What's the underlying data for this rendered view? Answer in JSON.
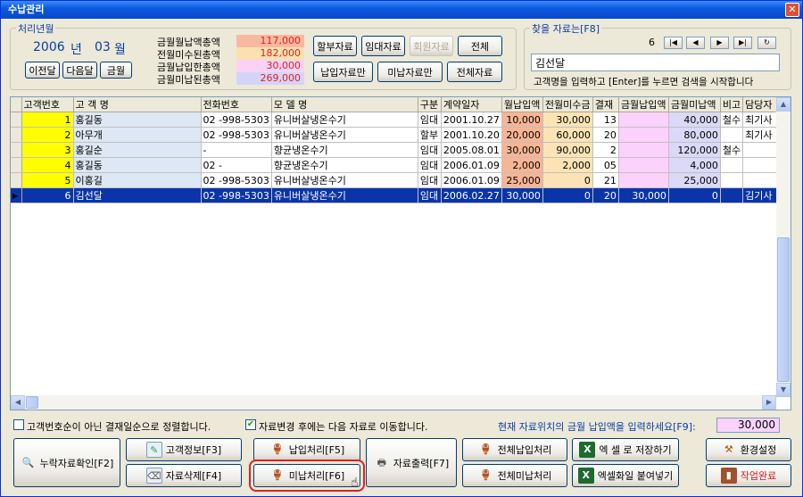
{
  "window": {
    "title": "수납관리"
  },
  "period": {
    "group_title": "처리년월",
    "year": "2006",
    "year_unit": "년",
    "month": "03",
    "month_unit": "월",
    "prev_month": "이전달",
    "next_month": "다음달",
    "this_month": "금월"
  },
  "summary": {
    "rows": [
      {
        "label": "금월월납액총액",
        "value": "117,000",
        "color": "#f9b9a0"
      },
      {
        "label": "전월미수된총액",
        "value": "182,000",
        "color": "#fbe0b0"
      },
      {
        "label": "금월납입한총액",
        "value": "30,000",
        "color": "#fbd2f5"
      },
      {
        "label": "금월미납된총액",
        "value": "269,000",
        "color": "#d4d4f9"
      }
    ]
  },
  "filters": {
    "installment": "할부자료",
    "rental": "임대자료",
    "member": "회원자료",
    "all": "전체",
    "paid_only": "납입자료만",
    "unpaid_only": "미납자료만",
    "all_data": "전체자료"
  },
  "search": {
    "group_title": "찾을 자료는[F8]",
    "position": "6",
    "value": "김선달",
    "hint": "고객명을 입력하고 [Enter]를 누르면 검색을 시작합니다"
  },
  "grid": {
    "columns": [
      "고객번호",
      "고 객 명",
      "전화번호",
      "모  델  명",
      "구분",
      "계약일자",
      "월납입액",
      "전월미수금",
      "결재",
      "금월납입액",
      "금월미납액",
      "비고",
      "담당자"
    ],
    "rows": [
      {
        "code": "1",
        "name": "홍길동",
        "phone": "02  -998-5303",
        "model": "유니버살냉온수기",
        "type": "임대",
        "date": "2001.10.27",
        "monthly": "10,000",
        "prev": "30,000",
        "day": "13",
        "paid": "",
        "unpaid": "40,000",
        "note": "철수",
        "manager": "최기사"
      },
      {
        "code": "2",
        "name": "아무개",
        "phone": "02  -998-5303",
        "model": "유니버살냉온수기",
        "type": "할부",
        "date": "2001.10.20",
        "monthly": "20,000",
        "prev": "60,000",
        "day": "20",
        "paid": "",
        "unpaid": "80,000",
        "note": "",
        "manager": "최기사"
      },
      {
        "code": "3",
        "name": "홍길순",
        "phone": "-",
        "model": "향균냉온수기",
        "type": "임대",
        "date": "2005.08.01",
        "monthly": "30,000",
        "prev": "90,000",
        "day": "2",
        "paid": "",
        "unpaid": "120,000",
        "note": "철수",
        "manager": ""
      },
      {
        "code": "4",
        "name": "홍길동",
        "phone": "02  -",
        "model": "향균냉온수기",
        "type": "임대",
        "date": "2006.01.09",
        "monthly": "2,000",
        "prev": "2,000",
        "day": "05",
        "paid": "",
        "unpaid": "4,000",
        "note": "",
        "manager": ""
      },
      {
        "code": "5",
        "name": "이홍길",
        "phone": "02  -998-5303",
        "model": "유니버살냉온수기",
        "type": "임대",
        "date": "2006.01.09",
        "monthly": "25,000",
        "prev": "0",
        "day": "21",
        "paid": "",
        "unpaid": "25,000",
        "note": "",
        "manager": ""
      },
      {
        "code": "6",
        "name": "김선달",
        "phone": "02  -998-5303",
        "model": "유니버살냉온수기",
        "type": "임대",
        "date": "2006.02.27",
        "monthly": "30,000",
        "prev": "0",
        "day": "20",
        "paid": "30,000",
        "unpaid": "0",
        "note": "",
        "manager": "김기사"
      }
    ]
  },
  "options": {
    "sort_by_day": "고객번호순이 아닌 결재일순으로 정렬합니다.",
    "sort_by_day_checked": false,
    "move_next": "자료변경 후에는 다음 자료로 이동합니다.",
    "move_next_checked": true,
    "pay_prompt": "현재 자료위치의 금월 납입액을 입력하세요[F9]:",
    "pay_value": "30,000"
  },
  "actions": {
    "check_missing": "누락자료확인[F2]",
    "customer_info": "고객정보[F3]",
    "delete": "자료삭제[F4]",
    "pay": "납입처리[F5]",
    "unpaid": "미납처리[F6]",
    "print": "자료출력[F7]",
    "all_pay": "전체납입처리",
    "all_unpaid": "전체미납처리",
    "save_excel": "엑 셀 로 저장하기",
    "paste_excel": "엑셀화일 붙여넣기",
    "settings": "환경설정",
    "done": "작업완료"
  }
}
